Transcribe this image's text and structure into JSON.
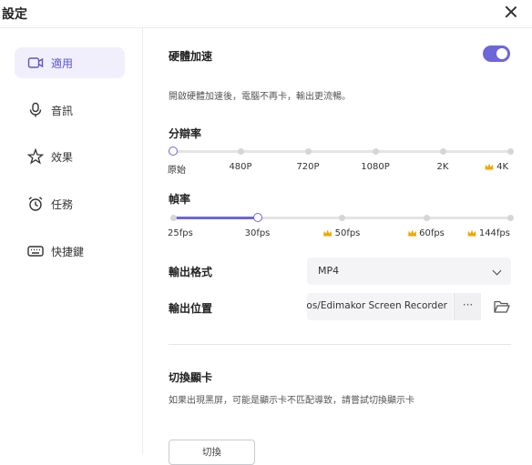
{
  "window": {
    "title": "設定"
  },
  "sidebar": {
    "items": [
      {
        "label": "適用",
        "icon": "camera-icon",
        "active": true
      },
      {
        "label": "音訊",
        "icon": "microphone-icon",
        "active": false
      },
      {
        "label": "效果",
        "icon": "effect-star-icon",
        "active": false
      },
      {
        "label": "任務",
        "icon": "alarm-clock-icon",
        "active": false
      },
      {
        "label": "快捷鍵",
        "icon": "keyboard-icon",
        "active": false
      }
    ]
  },
  "hardware": {
    "title": "硬體加速",
    "enabled": true,
    "description": "開啟硬體加速後，電腦不再卡，輸出更流暢。"
  },
  "resolution": {
    "title": "分辯率",
    "options": [
      "原始",
      "480P",
      "720P",
      "1080P",
      "2K",
      "4K"
    ],
    "premium": [
      false,
      false,
      false,
      false,
      false,
      true
    ],
    "selected_index": 0
  },
  "framerate": {
    "title": "幀率",
    "options": [
      "25fps",
      "30fps",
      "50fps",
      "60fps",
      "144fps"
    ],
    "premium": [
      false,
      false,
      true,
      true,
      true
    ],
    "selected_index": 1
  },
  "output": {
    "format_label": "輸出格式",
    "format_value": "MP4",
    "location_label": "輸出位置",
    "location_value": "eos/Edimakor Screen Recorder",
    "more_label": "···"
  },
  "gpu": {
    "title": "切換顯卡",
    "description": "如果出現黑屏，可能是顯示卡不匹配導致，請嘗試切換顯示卡",
    "button_label": "切換"
  },
  "colors": {
    "accent": "#6c66d9",
    "crown": "#f0a800"
  }
}
